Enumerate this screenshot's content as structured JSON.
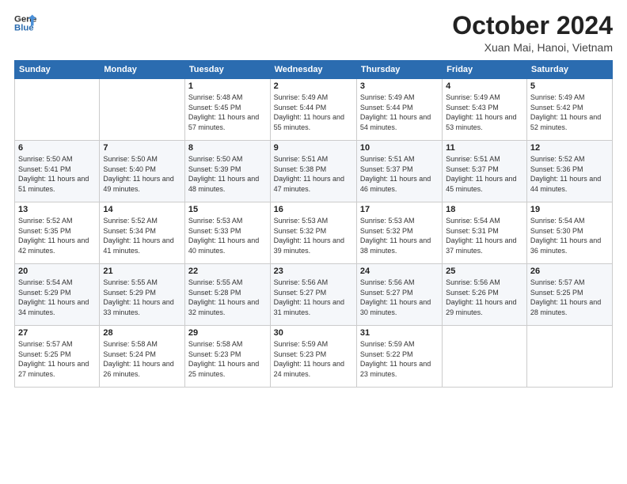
{
  "header": {
    "logo_general": "General",
    "logo_blue": "Blue",
    "month_title": "October 2024",
    "location": "Xuan Mai, Hanoi, Vietnam"
  },
  "weekdays": [
    "Sunday",
    "Monday",
    "Tuesday",
    "Wednesday",
    "Thursday",
    "Friday",
    "Saturday"
  ],
  "weeks": [
    [
      {
        "day": "",
        "sunrise": "",
        "sunset": "",
        "daylight": ""
      },
      {
        "day": "",
        "sunrise": "",
        "sunset": "",
        "daylight": ""
      },
      {
        "day": "1",
        "sunrise": "Sunrise: 5:48 AM",
        "sunset": "Sunset: 5:45 PM",
        "daylight": "Daylight: 11 hours and 57 minutes."
      },
      {
        "day": "2",
        "sunrise": "Sunrise: 5:49 AM",
        "sunset": "Sunset: 5:44 PM",
        "daylight": "Daylight: 11 hours and 55 minutes."
      },
      {
        "day": "3",
        "sunrise": "Sunrise: 5:49 AM",
        "sunset": "Sunset: 5:44 PM",
        "daylight": "Daylight: 11 hours and 54 minutes."
      },
      {
        "day": "4",
        "sunrise": "Sunrise: 5:49 AM",
        "sunset": "Sunset: 5:43 PM",
        "daylight": "Daylight: 11 hours and 53 minutes."
      },
      {
        "day": "5",
        "sunrise": "Sunrise: 5:49 AM",
        "sunset": "Sunset: 5:42 PM",
        "daylight": "Daylight: 11 hours and 52 minutes."
      }
    ],
    [
      {
        "day": "6",
        "sunrise": "Sunrise: 5:50 AM",
        "sunset": "Sunset: 5:41 PM",
        "daylight": "Daylight: 11 hours and 51 minutes."
      },
      {
        "day": "7",
        "sunrise": "Sunrise: 5:50 AM",
        "sunset": "Sunset: 5:40 PM",
        "daylight": "Daylight: 11 hours and 49 minutes."
      },
      {
        "day": "8",
        "sunrise": "Sunrise: 5:50 AM",
        "sunset": "Sunset: 5:39 PM",
        "daylight": "Daylight: 11 hours and 48 minutes."
      },
      {
        "day": "9",
        "sunrise": "Sunrise: 5:51 AM",
        "sunset": "Sunset: 5:38 PM",
        "daylight": "Daylight: 11 hours and 47 minutes."
      },
      {
        "day": "10",
        "sunrise": "Sunrise: 5:51 AM",
        "sunset": "Sunset: 5:37 PM",
        "daylight": "Daylight: 11 hours and 46 minutes."
      },
      {
        "day": "11",
        "sunrise": "Sunrise: 5:51 AM",
        "sunset": "Sunset: 5:37 PM",
        "daylight": "Daylight: 11 hours and 45 minutes."
      },
      {
        "day": "12",
        "sunrise": "Sunrise: 5:52 AM",
        "sunset": "Sunset: 5:36 PM",
        "daylight": "Daylight: 11 hours and 44 minutes."
      }
    ],
    [
      {
        "day": "13",
        "sunrise": "Sunrise: 5:52 AM",
        "sunset": "Sunset: 5:35 PM",
        "daylight": "Daylight: 11 hours and 42 minutes."
      },
      {
        "day": "14",
        "sunrise": "Sunrise: 5:52 AM",
        "sunset": "Sunset: 5:34 PM",
        "daylight": "Daylight: 11 hours and 41 minutes."
      },
      {
        "day": "15",
        "sunrise": "Sunrise: 5:53 AM",
        "sunset": "Sunset: 5:33 PM",
        "daylight": "Daylight: 11 hours and 40 minutes."
      },
      {
        "day": "16",
        "sunrise": "Sunrise: 5:53 AM",
        "sunset": "Sunset: 5:32 PM",
        "daylight": "Daylight: 11 hours and 39 minutes."
      },
      {
        "day": "17",
        "sunrise": "Sunrise: 5:53 AM",
        "sunset": "Sunset: 5:32 PM",
        "daylight": "Daylight: 11 hours and 38 minutes."
      },
      {
        "day": "18",
        "sunrise": "Sunrise: 5:54 AM",
        "sunset": "Sunset: 5:31 PM",
        "daylight": "Daylight: 11 hours and 37 minutes."
      },
      {
        "day": "19",
        "sunrise": "Sunrise: 5:54 AM",
        "sunset": "Sunset: 5:30 PM",
        "daylight": "Daylight: 11 hours and 36 minutes."
      }
    ],
    [
      {
        "day": "20",
        "sunrise": "Sunrise: 5:54 AM",
        "sunset": "Sunset: 5:29 PM",
        "daylight": "Daylight: 11 hours and 34 minutes."
      },
      {
        "day": "21",
        "sunrise": "Sunrise: 5:55 AM",
        "sunset": "Sunset: 5:29 PM",
        "daylight": "Daylight: 11 hours and 33 minutes."
      },
      {
        "day": "22",
        "sunrise": "Sunrise: 5:55 AM",
        "sunset": "Sunset: 5:28 PM",
        "daylight": "Daylight: 11 hours and 32 minutes."
      },
      {
        "day": "23",
        "sunrise": "Sunrise: 5:56 AM",
        "sunset": "Sunset: 5:27 PM",
        "daylight": "Daylight: 11 hours and 31 minutes."
      },
      {
        "day": "24",
        "sunrise": "Sunrise: 5:56 AM",
        "sunset": "Sunset: 5:27 PM",
        "daylight": "Daylight: 11 hours and 30 minutes."
      },
      {
        "day": "25",
        "sunrise": "Sunrise: 5:56 AM",
        "sunset": "Sunset: 5:26 PM",
        "daylight": "Daylight: 11 hours and 29 minutes."
      },
      {
        "day": "26",
        "sunrise": "Sunrise: 5:57 AM",
        "sunset": "Sunset: 5:25 PM",
        "daylight": "Daylight: 11 hours and 28 minutes."
      }
    ],
    [
      {
        "day": "27",
        "sunrise": "Sunrise: 5:57 AM",
        "sunset": "Sunset: 5:25 PM",
        "daylight": "Daylight: 11 hours and 27 minutes."
      },
      {
        "day": "28",
        "sunrise": "Sunrise: 5:58 AM",
        "sunset": "Sunset: 5:24 PM",
        "daylight": "Daylight: 11 hours and 26 minutes."
      },
      {
        "day": "29",
        "sunrise": "Sunrise: 5:58 AM",
        "sunset": "Sunset: 5:23 PM",
        "daylight": "Daylight: 11 hours and 25 minutes."
      },
      {
        "day": "30",
        "sunrise": "Sunrise: 5:59 AM",
        "sunset": "Sunset: 5:23 PM",
        "daylight": "Daylight: 11 hours and 24 minutes."
      },
      {
        "day": "31",
        "sunrise": "Sunrise: 5:59 AM",
        "sunset": "Sunset: 5:22 PM",
        "daylight": "Daylight: 11 hours and 23 minutes."
      },
      {
        "day": "",
        "sunrise": "",
        "sunset": "",
        "daylight": ""
      },
      {
        "day": "",
        "sunrise": "",
        "sunset": "",
        "daylight": ""
      }
    ]
  ]
}
